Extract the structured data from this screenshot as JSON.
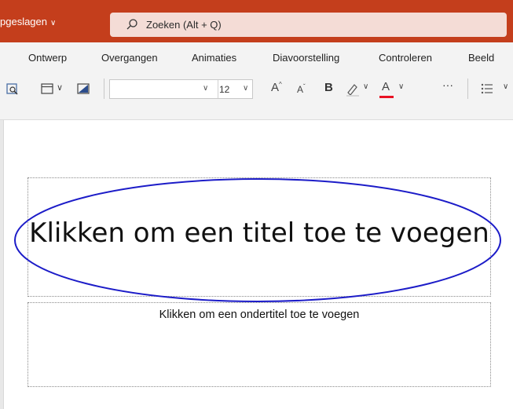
{
  "titlebar": {
    "saved_status": "pgeslagen",
    "search_placeholder": "Zoeken (Alt + Q)",
    "accent_color": "#c43e1c"
  },
  "ribbon_tabs": [
    "Ontwerp",
    "Overgangen",
    "Animaties",
    "Diavoorstelling",
    "Controleren",
    "Beeld"
  ],
  "toolbar": {
    "font_name": "",
    "font_size": "12",
    "grow_font": "A",
    "shrink_font": "A",
    "bold": "B",
    "font_color": "A",
    "more": "···",
    "font_color_swatch": "#e81123"
  },
  "slide": {
    "title_placeholder": "Klikken om een titel toe te voegen",
    "subtitle_placeholder": "Klikken om een ondertitel toe te voegen",
    "annotation_color": "#1c1cc8"
  }
}
